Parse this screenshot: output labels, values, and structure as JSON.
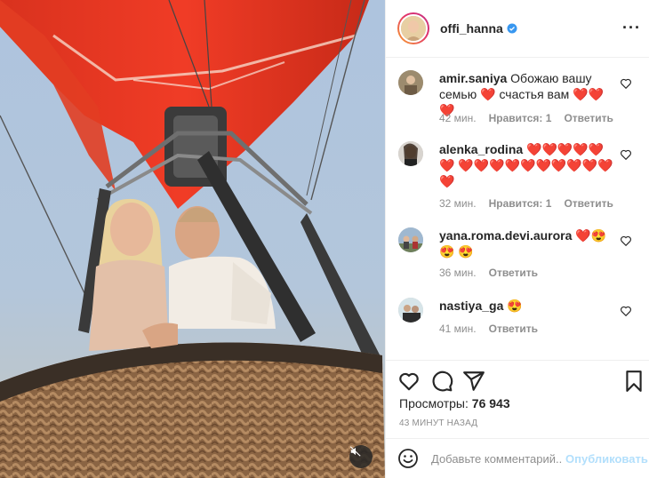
{
  "post": {
    "username": "offi_hanna",
    "more_icon": "more-dots-icon",
    "verified_icon": "verified-badge-icon"
  },
  "comments": [
    {
      "user": "amir.saniya",
      "text_line1": "Обожаю вашу",
      "text_line2a": "семью",
      "text_line2b": "счастья вам",
      "time": "42 мин.",
      "likes": "Нравится: 1",
      "reply": "Ответить"
    },
    {
      "user": "alenka_rodina",
      "time": "32 мин.",
      "likes": "Нравится: 1",
      "reply": "Ответить"
    },
    {
      "user": "yana.roma.devi.aurora",
      "time": "36 мин.",
      "reply": "Ответить"
    },
    {
      "user": "nastiya_ga",
      "time": "41 мин.",
      "reply": "Ответить"
    }
  ],
  "stats": {
    "views_label": "Просмотры:",
    "views_value": "76 943",
    "timestamp": "43 МИНУТ НАЗАД"
  },
  "composer": {
    "placeholder": "Добавьте комментарий...",
    "publish_label": "Опубликовать"
  },
  "colors": {
    "accent_blue": "#0095f6",
    "publish_disabled": "#b2dffc",
    "heart_red": "#ed1c24"
  }
}
